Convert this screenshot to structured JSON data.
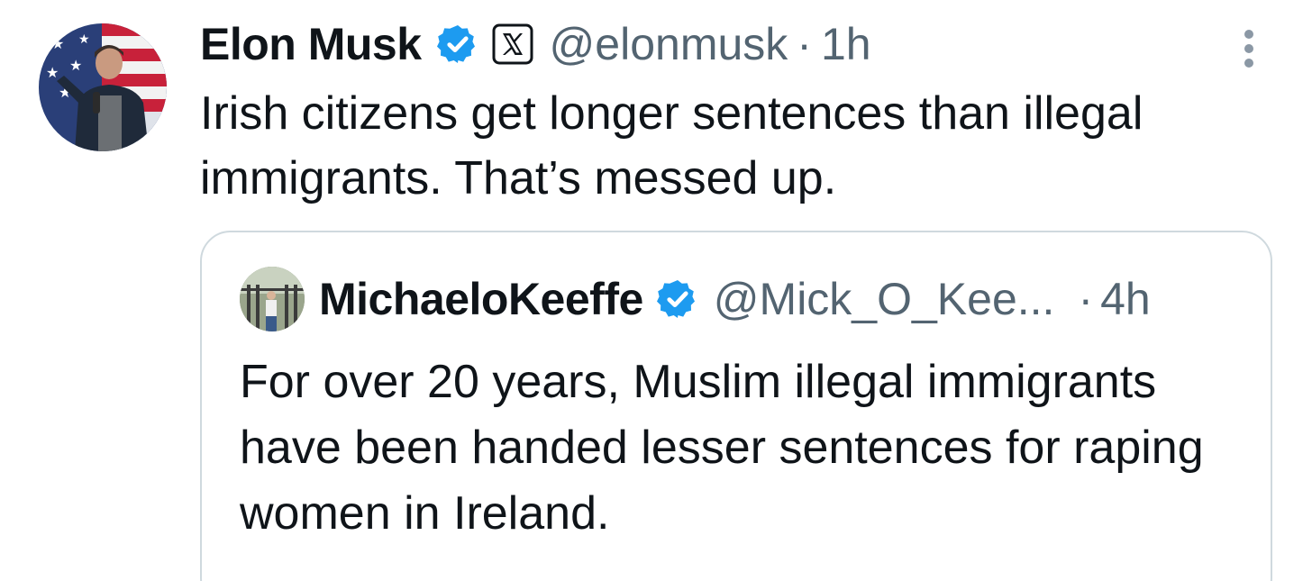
{
  "tweet": {
    "author": {
      "name": "Elon Musk",
      "handle": "@elonmusk",
      "verified_icon": "verified-badge-icon",
      "affiliation_icon": "x-logo-icon"
    },
    "separator": "·",
    "time": "1h",
    "text": "Irish citizens get longer sentences than illegal immigrants. That’s messed up.",
    "more_icon": "more-vertical-icon"
  },
  "quote": {
    "author": {
      "name": "MichaeloKeeffe",
      "handle": "@Mick_O_Kee...",
      "verified_icon": "verified-badge-icon"
    },
    "separator": "·",
    "time": "4h",
    "text": "For over 20 years, Muslim illegal immigrants have been handed lesser sentences for raping women in Ireland."
  },
  "colors": {
    "verified_blue": "#1d9bf0",
    "secondary_text": "#536471",
    "primary_text": "#0f1419",
    "border": "#cfd9de"
  }
}
